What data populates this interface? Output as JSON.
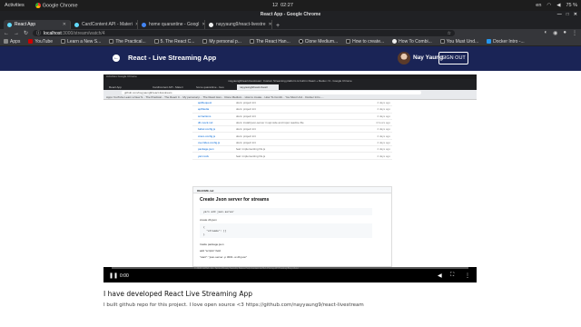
{
  "os": {
    "activities": "Activities",
    "app": "Google Chrome",
    "date": "12",
    "time": "02:27",
    "lang": "en",
    "battery": "75 %"
  },
  "window": {
    "title": "React App - Google Chrome"
  },
  "tabs": [
    {
      "label": "React App",
      "active": true
    },
    {
      "label": "CardContent API - Materi"
    },
    {
      "label": "home quarantine - Googl"
    },
    {
      "label": "nayyaung9/react-livestre"
    }
  ],
  "toolbar": {
    "host": "localhost",
    "path": ":3000/stream/watch/4"
  },
  "bookmarks": [
    "Apps",
    "YouTube",
    "Learn a New S...",
    "The Practical...",
    "5. The React C...",
    "My personal p...",
    "The React Han...",
    "Clone Medium...",
    "How to create...",
    "How To Combi...",
    "You Must Und...",
    "Docker Intro -..."
  ],
  "app": {
    "title": "React - Live Streaming App",
    "user_name": "Nay Yaung",
    "signout_label": "SIGN OUT"
  },
  "video": {
    "inner_window_title": "nayyaung9/react-livestream: Custom Streaming platform is built in React + Redux <3 - Google Chrome",
    "inner_tabs": [
      "React App",
      "CardContent API - Materi",
      "home quarantine - Goo",
      "nayyaung9/react-livestr"
    ],
    "inner_url": "github.com/nayyaung9/react-livestream",
    "inner_bookmarks": "Apps   YouTube   Learn a New S...   The Practical...   The React C...   My personal p...   The React Han...   Clone Medium...   How to create...   How To Combi...   You Must Und...   Docker Intro -...",
    "files": [
      {
        "name": "apiRequest",
        "msg": "docs: project init",
        "time": "4 days ago"
      },
      {
        "name": "apiMedia",
        "msg": "docs: project init",
        "time": "4 days ago"
      },
      {
        "name": "src/actions",
        "msg": "docs: project init",
        "time": "4 days ago"
      },
      {
        "name": "db.mock.md",
        "msg": "docs: install json-server in api side and input readme file",
        "time": "4 hours ago"
      },
      {
        "name": "babel.config.js",
        "msg": "docs: project init",
        "time": "4 days ago"
      },
      {
        "name": "craco.config.js",
        "msg": "docs: project init",
        "time": "4 days ago"
      },
      {
        "name": "overrides.config.js",
        "msg": "docs: project init",
        "time": "4 days ago"
      },
      {
        "name": "package.json",
        "msg": "feat: implementing hls.js",
        "time": "4 days ago"
      },
      {
        "name": "yarn.lock",
        "msg": "feat: implementing hls.js",
        "time": "4 days ago"
      }
    ],
    "readme_label": "README.md",
    "readme_heading": "Create Json server for streams",
    "code1": "yarn add json-server",
    "p_create": "create db.json",
    "code2": "{\n  \"streams\": []\n}",
    "p_inside": "Inside package.json",
    "p_add": "add  \"scripts\" field",
    "p_start": "\"start\": \"json-server -p 3001 -w db.json\"",
    "inner_footer": "© 2020 GitHub, Inc.   Terms   Privacy   Security   Status   Help          Contact GitHub   Pricing   API   Training   Blog   About",
    "current_time": "0:00",
    "progress": 0.0
  },
  "description": {
    "title": "I have developed React Live Streaming App",
    "body": "I built github repo for this project. I love open source <3 https://github.com/nayyaung9/react-livestream"
  }
}
